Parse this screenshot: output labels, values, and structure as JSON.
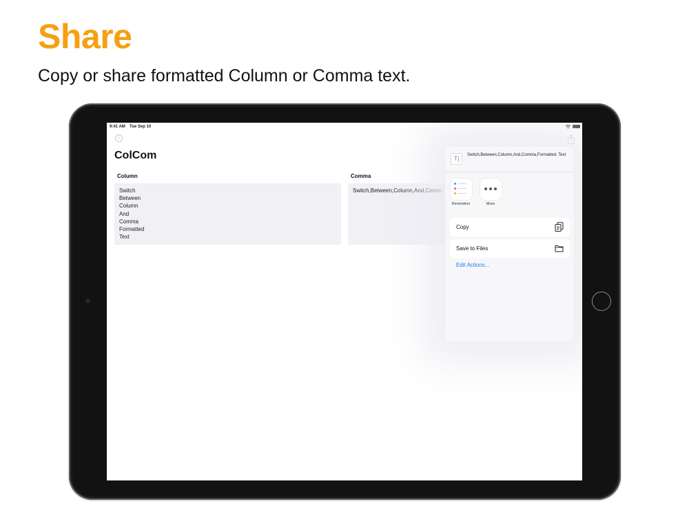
{
  "hero": {
    "title": "Share",
    "subtitle": "Copy or share formatted Column or Comma text."
  },
  "status_bar": {
    "time": "9:41 AM",
    "date": "Tue Sep 10"
  },
  "app": {
    "title": "ColCom",
    "column": {
      "label": "Column",
      "lines": [
        "Switch",
        "Between",
        "Column",
        "And",
        "Comma",
        "Formatted",
        "Text"
      ]
    },
    "comma": {
      "label": "Comma",
      "text": "Switch,Between,Column,And,Comm"
    }
  },
  "share_sheet": {
    "preview_text": "Switch,Between,Column,And,Comma,Formatted, Text",
    "apps": [
      {
        "label": "Reminders",
        "icon": "reminders-icon"
      },
      {
        "label": "More",
        "icon": "more-icon"
      }
    ],
    "actions": [
      {
        "label": "Copy",
        "icon": "copy-icon"
      },
      {
        "label": "Save to Files",
        "icon": "folder-icon"
      }
    ],
    "edit_actions": "Edit Actions..."
  },
  "colors": {
    "accent": "#f5a014",
    "link": "#1a7cf0",
    "field_bg": "#f0f0f5"
  }
}
